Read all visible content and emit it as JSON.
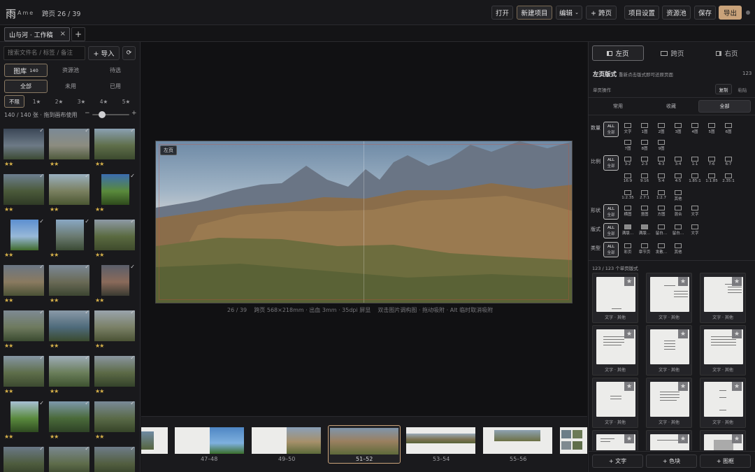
{
  "app": {
    "logo": "雨",
    "logo_sub": "Ame",
    "page_indicator": "跨页 26 / 39"
  },
  "toolbar": {
    "open": "打开",
    "new_project": "新建项目",
    "edit": "编辑",
    "add_spread": "+ 跨页",
    "project_settings": "项目设置",
    "asset_pool": "资源池",
    "save": "保存",
    "export": "导出"
  },
  "tabs": [
    {
      "label": "山与河 · 工作稿"
    }
  ],
  "left": {
    "search_placeholder": "搜索文件名 / 标签 / 备注",
    "import": "+ 导入",
    "source_tabs": [
      {
        "label": "图库",
        "count": "140"
      },
      {
        "label": "资源池"
      },
      {
        "label": "待选"
      }
    ],
    "filter_tabs": [
      "全部",
      "未用",
      "已用"
    ],
    "rating_tabs": [
      "不限",
      "1★",
      "2★",
      "3★",
      "4★",
      "5★"
    ],
    "count_text": "140 / 140 张 · 拖到画布使用",
    "zoom_minus": "−",
    "zoom_plus": "+",
    "thumbs": [
      {
        "stars": "★★",
        "check": "✓"
      },
      {
        "stars": "★★",
        "check": "✓"
      },
      {
        "stars": "★★",
        "check": "✓"
      },
      {
        "stars": "★★",
        "check": "✓"
      },
      {
        "stars": "★★",
        "check": "✓"
      },
      {
        "stars": "★★",
        "check": "✓"
      },
      {
        "stars": "★★",
        "check": "✓"
      },
      {
        "stars": "★★",
        "check": "✓"
      },
      {
        "stars": "★★",
        "check": "✓"
      },
      {
        "stars": "★★",
        "check": "✓"
      },
      {
        "stars": "★★",
        "check": "✓"
      },
      {
        "stars": "★★",
        "check": "✓"
      },
      {
        "stars": "★★",
        "check": "✓"
      },
      {
        "stars": "★★",
        "check": "✓"
      },
      {
        "stars": "★★",
        "check": "✓"
      },
      {
        "stars": "★★",
        "check": "✓"
      },
      {
        "stars": "★★",
        "check": "✓"
      },
      {
        "stars": "★★",
        "check": "✓"
      },
      {
        "stars": "★★",
        "check": "✓"
      },
      {
        "stars": "★★",
        "check": "✓"
      },
      {
        "stars": "★★",
        "check": "✓"
      },
      {
        "stars": "",
        "check": "✓"
      },
      {
        "stars": "",
        "check": "✓"
      },
      {
        "stars": "",
        "check": "✓"
      }
    ]
  },
  "canvas": {
    "left_label": "左页",
    "info": "26 / 39    跨页 568×218mm · 出血 3mm · 35dpi 屏显    双击图片调构图 · 拖动吸附 · Alt 临时取消吸附"
  },
  "filmstrip": [
    {
      "label": ""
    },
    {
      "label": "47–48"
    },
    {
      "label": "49–50"
    },
    {
      "label": "51–52"
    },
    {
      "label": "53–54"
    },
    {
      "label": "55–56"
    },
    {
      "label": ""
    }
  ],
  "right": {
    "page_tabs": [
      "左页",
      "跨页",
      "右页"
    ],
    "layout_title": "左页版式",
    "layout_hint": "重新点击版式即可还原页面",
    "layout_count": "123",
    "single_ops": "单页操作",
    "copy": "复制",
    "paste": "粘贴",
    "cat_tabs": [
      "常用",
      "收藏",
      "全部"
    ],
    "rows": [
      {
        "label": "数量",
        "items": [
          "全部",
          "文字",
          "1图",
          "2图",
          "3图",
          "4图",
          "5图",
          "6图",
          "7图",
          "8图",
          "9图"
        ]
      },
      {
        "label": "比例",
        "items": [
          "全部",
          "3:2",
          "2:3",
          "4:3",
          "3:4",
          "1:1",
          "7:6",
          "6:7",
          "16:9",
          "9:16",
          "5:4",
          "4:5",
          "1.85:1",
          "1:1.85",
          "2.35:1",
          "1:2.35",
          "2.7:1",
          "1:2.7",
          "其他"
        ]
      },
      {
        "label": "形状",
        "items": [
          "全部",
          "横图",
          "竖图",
          "方图",
          "混合",
          "文字"
        ]
      },
      {
        "label": "版式",
        "items": [
          "全部",
          "满版…",
          "满版…",
          "留白…",
          "留白…",
          "文字"
        ]
      },
      {
        "label": "类型",
        "items": [
          "全部",
          "彩页",
          "章节页",
          "发散…",
          "其他"
        ]
      }
    ],
    "all_label": "ALL",
    "result_count": "123 / 123 个单页版式",
    "cells": [
      {
        "cap": "文字 · 其他"
      },
      {
        "cap": "文字 · 其他"
      },
      {
        "cap": "文字 · 其他"
      },
      {
        "cap": "文字 · 其他"
      },
      {
        "cap": "文字 · 其他"
      },
      {
        "cap": "文字 · 其他"
      },
      {
        "cap": "文字 · 其他"
      },
      {
        "cap": "文字 · 其他"
      },
      {
        "cap": "文字 · 其他"
      },
      {
        "cap": ""
      },
      {
        "cap": ""
      },
      {
        "cap": ""
      }
    ],
    "bottom": [
      "+ 文字",
      "+ 色块",
      "+ 图框"
    ]
  },
  "colors": {
    "accent": "#c9a27a",
    "bg": "#141416",
    "panel": "#1b1b1e"
  }
}
